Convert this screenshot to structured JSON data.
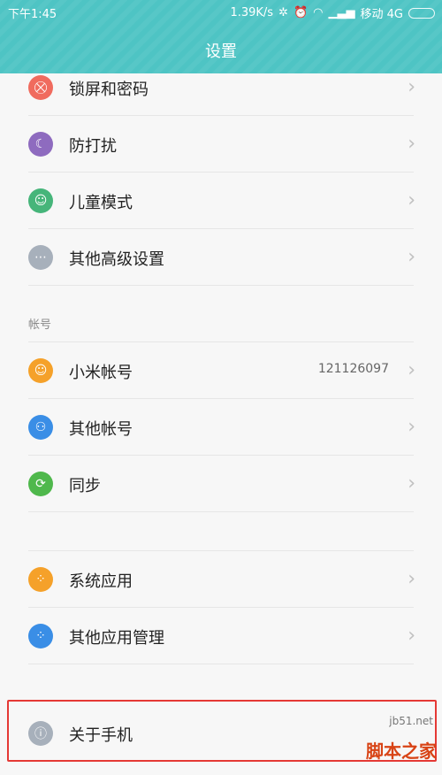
{
  "status_bar": {
    "time": "下午1:45",
    "speed": "1.39K/s",
    "carrier": "移动 4G"
  },
  "header": {
    "title": "设置"
  },
  "rows": [
    {
      "label": "锁屏和密码",
      "icon": "lock-icon",
      "color": "#f06b5e",
      "glyph": "⛒"
    },
    {
      "label": "防打扰",
      "icon": "moon-icon",
      "color": "#8e6bbf",
      "glyph": "☾"
    },
    {
      "label": "儿童模式",
      "icon": "child-mode-icon",
      "color": "#46b57a",
      "glyph": "☺"
    },
    {
      "label": "其他高级设置",
      "icon": "more-icon",
      "color": "#a7b0bb",
      "glyph": "⋯"
    }
  ],
  "accounts_section": {
    "label": "帐号",
    "rows": [
      {
        "label": "小米帐号",
        "value": "121126097",
        "icon": "mi-account-icon",
        "color": "#f5a12a",
        "glyph": "☺"
      },
      {
        "label": "其他帐号",
        "icon": "account-add-icon",
        "color": "#3a8ee6",
        "glyph": "⚇"
      },
      {
        "label": "同步",
        "icon": "sync-icon",
        "color": "#4fb84c",
        "glyph": "⟳"
      }
    ]
  },
  "apps_section": {
    "rows": [
      {
        "label": "系统应用",
        "icon": "system-apps-icon",
        "color": "#f5a12a",
        "glyph": "⁘"
      },
      {
        "label": "其他应用管理",
        "icon": "app-manage-icon",
        "color": "#3a8ee6",
        "glyph": "⁘"
      }
    ]
  },
  "about_row": {
    "label": "关于手机",
    "icon": "info-icon",
    "color": "#a7b0bb",
    "glyph": "ⓘ"
  },
  "watermark": {
    "url": "jb51.net",
    "text": "脚本之家"
  }
}
